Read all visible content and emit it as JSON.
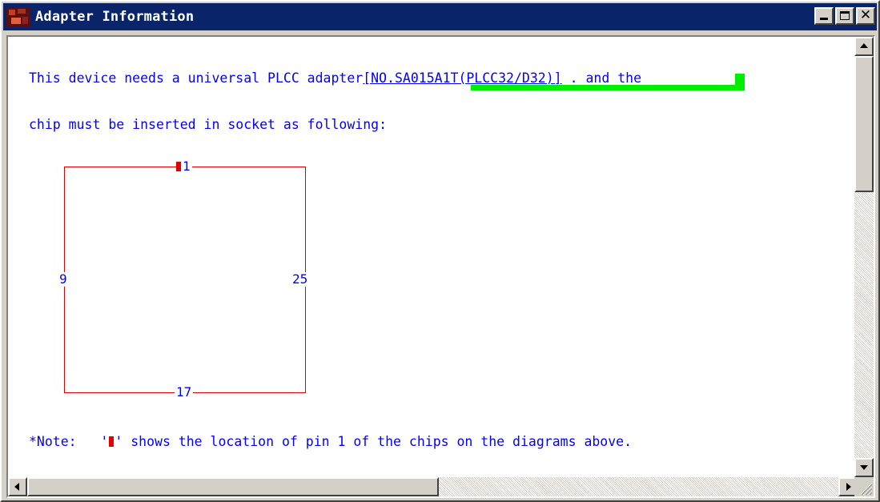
{
  "window": {
    "title": "Adapter Information"
  },
  "content": {
    "line1_a": "This device needs a universal PLCC adapter",
    "line1_adapter": "[NO.SA015A1T(PLCC32/D32)]",
    "line1_b": ". and the",
    "line2": "chip must be inserted in socket as following:",
    "note_prefix": "*Note:   '",
    "note_suffix": "' shows the location of pin 1 of the chips on the diagrams above."
  },
  "diagram": {
    "pin_top": "1",
    "pin_left": "9",
    "pin_right": "25",
    "pin_bottom": "17"
  },
  "colors": {
    "text": "#0000ff",
    "outline": "#e00000",
    "highlight": "#00ee00",
    "titlebar": "#0a246a"
  },
  "icons": [
    "app-icon",
    "minimize-icon",
    "maximize-icon",
    "close-icon",
    "scroll-up-icon",
    "scroll-down-icon",
    "scroll-left-icon",
    "scroll-right-icon",
    "size-grip-icon"
  ]
}
